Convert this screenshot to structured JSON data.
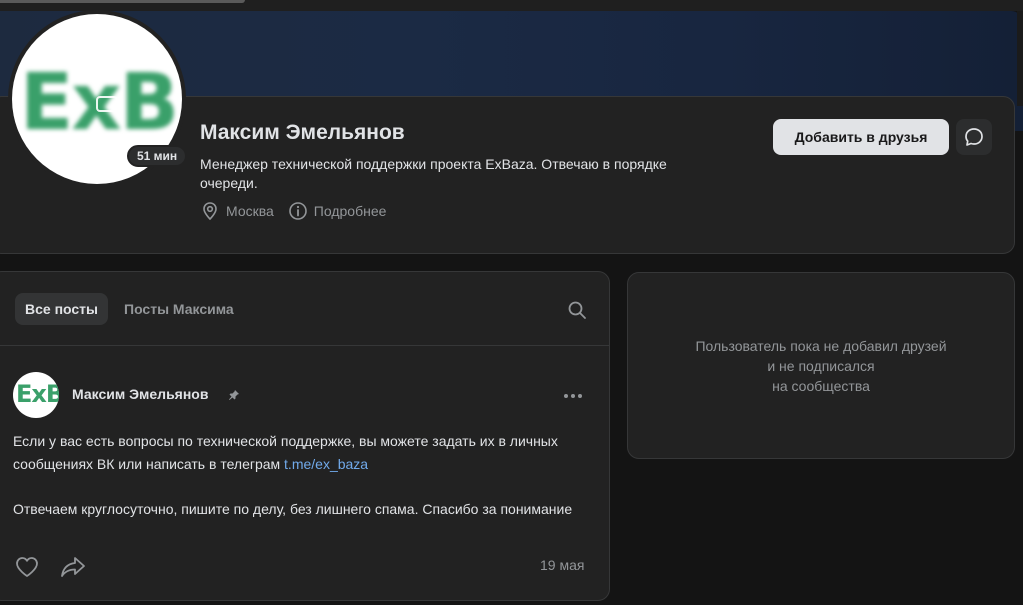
{
  "profile": {
    "name": "Максим Эмельянов",
    "online_badge": "51 мин",
    "status": "Менеджер технической поддержки проекта ExBaza. Отвечаю в порядке очереди.",
    "location": "Москва",
    "more_info": "Подробнее",
    "add_friend_label": "Добавить в друзья",
    "icons": {
      "location": "location-pin-icon",
      "info": "info-circle-icon",
      "message": "message-bubble-icon"
    }
  },
  "posts": {
    "tabs": [
      {
        "label": "Все посты",
        "active": true
      },
      {
        "label": "Посты Максима",
        "active": false
      }
    ],
    "items": [
      {
        "author": "Максим Эмельянов",
        "pinned": true,
        "text_part1": "Если у вас есть вопросы по технической поддержке, вы можете задать их в личных сообщениях ВК или написать в телеграм ",
        "link": "t.me/ex_baza",
        "text_part2": "Отвечаем круглосуточно, пишите по делу, без лишнего спама. Спасибо за понимание",
        "date": "19 мая"
      }
    ]
  },
  "friends": {
    "empty_line1": "Пользователь пока не добавил друзей",
    "empty_line2": "и не подписался",
    "empty_line3": "на сообщества"
  },
  "colors": {
    "background": "#141414",
    "card": "#222222",
    "text_primary": "#e1e3e6",
    "text_secondary": "#939699",
    "link": "#71aaeb",
    "button_light": "#e1e3e6"
  }
}
